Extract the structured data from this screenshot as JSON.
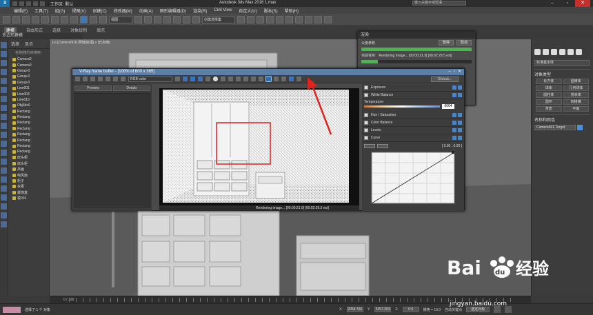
{
  "app": {
    "logo": "3",
    "title": "Autodesk 3ds Max 2016     1.max",
    "workspace_label": "工作区: 默认",
    "workspace_value": "默认",
    "search_placeholder": "键入关键字或短语"
  },
  "menu": [
    "编辑(E)",
    "工具(T)",
    "组(G)",
    "视图(V)",
    "创建(C)",
    "修改器(M)",
    "动画(A)",
    "图形编辑器(D)",
    "渲染(R)",
    "Civil View",
    "自定义(U)",
    "脚本(S)",
    "帮助(H)"
  ],
  "toolbar": {
    "view_select": "视图",
    "selection_set": "创建选择集"
  },
  "ribbon": {
    "tabs": [
      "建模",
      "自由形式",
      "选择",
      "对象绘制",
      "填充"
    ],
    "active": "建模",
    "sub": "多边形建模"
  },
  "explorer": {
    "tabs": [
      "选择",
      "显示"
    ],
    "column_header": "名称(按升序排序)",
    "items": [
      "Camera0",
      "Camera0",
      "Group-0",
      "Group-0",
      "Group-0",
      "Line001",
      "Line003",
      "Line010",
      "Obj3ds0",
      "Rectang",
      "Rectang",
      "Rectang",
      "Rectang",
      "Rectang",
      "Rectang",
      "Rectang",
      "Rectang",
      "床头柜",
      "床头柜",
      "吊画",
      "电风扇",
      "柜子",
      "衣柜",
      "装饰盒",
      "镜001"
    ]
  },
  "viewport": {
    "label": "[+] [Camera001] [明暗处理] + [已启用]"
  },
  "progress_dialog": {
    "title": "渲染",
    "row1_label": "公用参数",
    "pause": "暂停",
    "cancel": "取消",
    "row2_label": "当前任务:",
    "row2_text": "Rendering image... [00:00:21.9] [00:02:29.5 est]",
    "progress": 0.15
  },
  "vfb": {
    "title": "V-Ray frame buffer - [100% of 600 x 365]",
    "channel": "RGB color",
    "globals": "Globals...",
    "tab_preview": "Preview",
    "tab_details": "Details",
    "status": "Rendering image... [00:00:21.9] [00:02:29.5 est]",
    "corrections": {
      "exposure": "Exposure",
      "white_balance": "White Balance",
      "temperature_label": "Temperature",
      "temperature_value": "6064",
      "hue_saturation": "Hue / Saturation",
      "color_balance": "Color Balance",
      "levels": "Levels",
      "curve": "Curve",
      "curve_coords": "[ 0.00 ; 0.00 ]"
    }
  },
  "right_panel": {
    "category": "标准基本体",
    "section_object_type": "对象类型",
    "buttons": [
      "长方体",
      "圆锥体",
      "球体",
      "几何球体",
      "圆柱体",
      "管状体",
      "圆环",
      "四棱锥",
      "茶壶",
      "平面"
    ],
    "section_name_color": "名称和颜色",
    "name_value": "Camera001.Target"
  },
  "timeline": {
    "frame": "0 / 100"
  },
  "status": {
    "message": "选择了 1 个 对象",
    "x_label": "X:",
    "x_value": "2054.766",
    "y_label": "Y:",
    "y_value": "5257.203",
    "z_label": "Z:",
    "z_value": "0.0",
    "grid": "栅格 = 10.0",
    "auto_key": "自动关键点",
    "selected": "选定对象"
  },
  "watermark": {
    "brand": "Bai du 经验",
    "url": "jingyan.baidu.com"
  },
  "colors": {
    "accent": "#3f78b6",
    "close": "#c4302b",
    "highlight_rect": "#e0211c",
    "progress": "#49b84c"
  }
}
